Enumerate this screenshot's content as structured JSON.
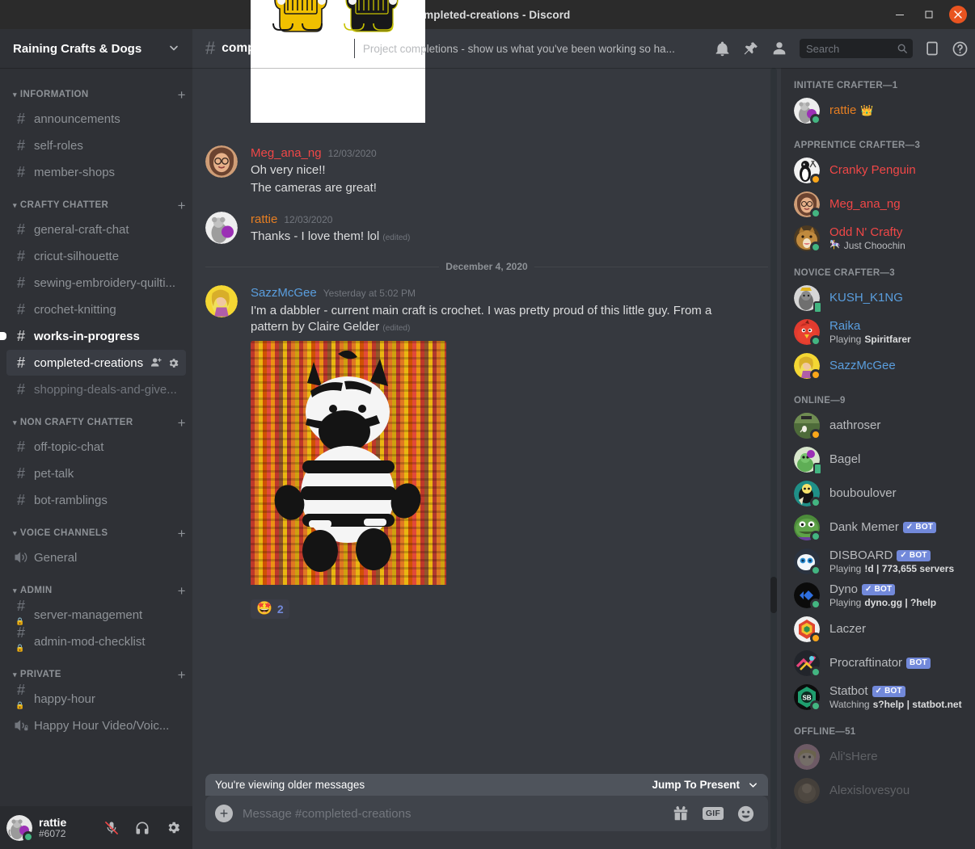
{
  "window": {
    "title": "#completed-creations - Discord",
    "minimize": "–",
    "maximize": "☐",
    "close": "✕"
  },
  "sidebar": {
    "server_name": "Raining Crafts & Dogs",
    "categories": [
      {
        "label": "INFORMATION",
        "channels": [
          {
            "name": "announcements",
            "type": "text",
            "state": "normal"
          },
          {
            "name": "self-roles",
            "type": "text",
            "state": "normal"
          },
          {
            "name": "member-shops",
            "type": "text",
            "state": "normal"
          }
        ]
      },
      {
        "label": "CRAFTY CHATTER",
        "channels": [
          {
            "name": "general-craft-chat",
            "type": "text",
            "state": "normal"
          },
          {
            "name": "cricut-silhouette",
            "type": "text",
            "state": "normal"
          },
          {
            "name": "sewing-embroidery-quilti...",
            "type": "text",
            "state": "normal"
          },
          {
            "name": "crochet-knitting",
            "type": "text",
            "state": "normal"
          },
          {
            "name": "works-in-progress",
            "type": "text",
            "state": "unread"
          },
          {
            "name": "completed-creations",
            "type": "text",
            "state": "active"
          },
          {
            "name": "shopping-deals-and-give...",
            "type": "text",
            "state": "muted"
          }
        ]
      },
      {
        "label": "NON CRAFTY CHATTER",
        "channels": [
          {
            "name": "off-topic-chat",
            "type": "text",
            "state": "normal"
          },
          {
            "name": "pet-talk",
            "type": "text",
            "state": "normal"
          },
          {
            "name": "bot-ramblings",
            "type": "text",
            "state": "normal"
          }
        ]
      },
      {
        "label": "VOICE CHANNELS",
        "channels": [
          {
            "name": "General",
            "type": "voice",
            "state": "normal"
          }
        ]
      },
      {
        "label": "ADMIN",
        "channels": [
          {
            "name": "server-management",
            "type": "text-locked",
            "state": "normal"
          },
          {
            "name": "admin-mod-checklist",
            "type": "text-locked",
            "state": "normal"
          }
        ]
      },
      {
        "label": "PRIVATE",
        "channels": [
          {
            "name": "happy-hour",
            "type": "text-locked",
            "state": "normal"
          },
          {
            "name": "Happy Hour Video/Voic...",
            "type": "voice-locked",
            "state": "normal"
          }
        ]
      }
    ],
    "add_channel_label": "+",
    "user": {
      "name": "rattie",
      "tag": "#6072",
      "mute_icon": "microphone-muted-icon",
      "deafen_icon": "headphones-icon",
      "settings_icon": "gear-icon"
    }
  },
  "header": {
    "channel_name": "completed-creations",
    "topic": "Project completions - show us what you've been working so ha...",
    "search_placeholder": "Search",
    "search_value": ""
  },
  "messages": [
    {
      "id": "m0",
      "type": "attachment-only",
      "attachment": "keychains-jeep-photo"
    },
    {
      "id": "m1",
      "author": "Meg_ana_ng",
      "author_color": "#f04747",
      "timestamp": "12/03/2020",
      "lines": [
        "Oh very nice!!",
        "The cameras are great!"
      ]
    },
    {
      "id": "m2",
      "author": "rattie",
      "author_color": "#e67e22",
      "timestamp": "12/03/2020",
      "lines": [
        "Thanks - I love them!  lol"
      ],
      "edited": "(edited)"
    },
    {
      "id": "divider",
      "type": "date-divider",
      "text": "December 4, 2020"
    },
    {
      "id": "m3",
      "author": "SazzMcGee",
      "author_color": "#5a9ede",
      "timestamp": "Yesterday at 5:02 PM",
      "lines": [
        "I'm a dabbler - current main craft is crochet.  I was pretty proud of this little guy.  From a pattern by Claire Gelder"
      ],
      "edited": "(edited)",
      "attachment": "crochet-zebra-photo",
      "reaction": {
        "emoji": "🤩",
        "count": "2"
      }
    }
  ],
  "composer": {
    "older_messages_text": "You're viewing older messages",
    "jump_label": "Jump To Present",
    "placeholder": "Message #completed-creations",
    "gift_icon": "gift-icon",
    "gif_label": "GIF",
    "emoji_icon": "emoji-icon",
    "plus_icon": "plus-icon"
  },
  "members": {
    "groups": [
      {
        "label": "INITIATE CRAFTER—1",
        "users": [
          {
            "name": "rattie",
            "color": "#e67e22",
            "status": "online",
            "crown": "👑",
            "avatar": "rattie"
          }
        ]
      },
      {
        "label": "APPRENTICE CRAFTER—3",
        "users": [
          {
            "name": "Cranky Penguin",
            "color": "#f04747",
            "status": "idle",
            "avatar": "penguin"
          },
          {
            "name": "Meg_ana_ng",
            "color": "#f04747",
            "status": "online",
            "avatar": "meg"
          },
          {
            "name": "Odd N' Crafty",
            "color": "#f04747",
            "status": "online",
            "avatar": "cat",
            "sub": "Just Choochin",
            "sub_emoji": "🎠"
          }
        ]
      },
      {
        "label": "NOVICE CRAFTER—3",
        "users": [
          {
            "name": "KUSH_K1NG",
            "color": "#5a9ede",
            "status": "mobile",
            "avatar": "kush"
          },
          {
            "name": "Raika",
            "color": "#5a9ede",
            "status": "online",
            "avatar": "raika",
            "sub_prefix": "Playing ",
            "sub_bold": "Spiritfarer"
          },
          {
            "name": "SazzMcGee",
            "color": "#5a9ede",
            "status": "idle",
            "avatar": "sazz"
          }
        ]
      },
      {
        "label": "ONLINE—9",
        "users": [
          {
            "name": "aathroser",
            "color": "#b9bbbe",
            "status": "idle",
            "avatar": "aath"
          },
          {
            "name": "Bagel",
            "color": "#b9bbbe",
            "status": "mobile",
            "avatar": "bagel"
          },
          {
            "name": "bouboulover",
            "color": "#b9bbbe",
            "status": "online",
            "avatar": "boub"
          },
          {
            "name": "Dank Memer",
            "color": "#b9bbbe",
            "status": "online",
            "avatar": "dank",
            "bot": "✓ BOT"
          },
          {
            "name": "DISBOARD",
            "color": "#b9bbbe",
            "status": "online",
            "avatar": "disboard",
            "bot": "✓ BOT",
            "sub_prefix": "Playing ",
            "sub_bold": "!d | 773,655 servers"
          },
          {
            "name": "Dyno",
            "color": "#b9bbbe",
            "status": "online",
            "avatar": "dyno",
            "bot": "✓ BOT",
            "sub_prefix": "Playing ",
            "sub_bold": "dyno.gg | ?help"
          },
          {
            "name": "Laczer",
            "color": "#b9bbbe",
            "status": "idle",
            "avatar": "laczer"
          },
          {
            "name": "Procraftinator",
            "color": "#b9bbbe",
            "status": "online",
            "avatar": "procraft",
            "bot": "BOT"
          },
          {
            "name": "Statbot",
            "color": "#b9bbbe",
            "status": "online",
            "avatar": "statbot",
            "bot": "✓ BOT",
            "sub_prefix": "Watching ",
            "sub_bold": "s?help | statbot.net"
          }
        ]
      },
      {
        "label": "OFFLINE—51",
        "users": [
          {
            "name": "Ali'sHere",
            "color": "#b9bbbe",
            "status": "offline",
            "avatar": "ali",
            "offline": true
          },
          {
            "name": "Alexislovesyou",
            "color": "#b9bbbe",
            "status": "offline",
            "avatar": "alex",
            "offline": true
          }
        ]
      }
    ]
  }
}
